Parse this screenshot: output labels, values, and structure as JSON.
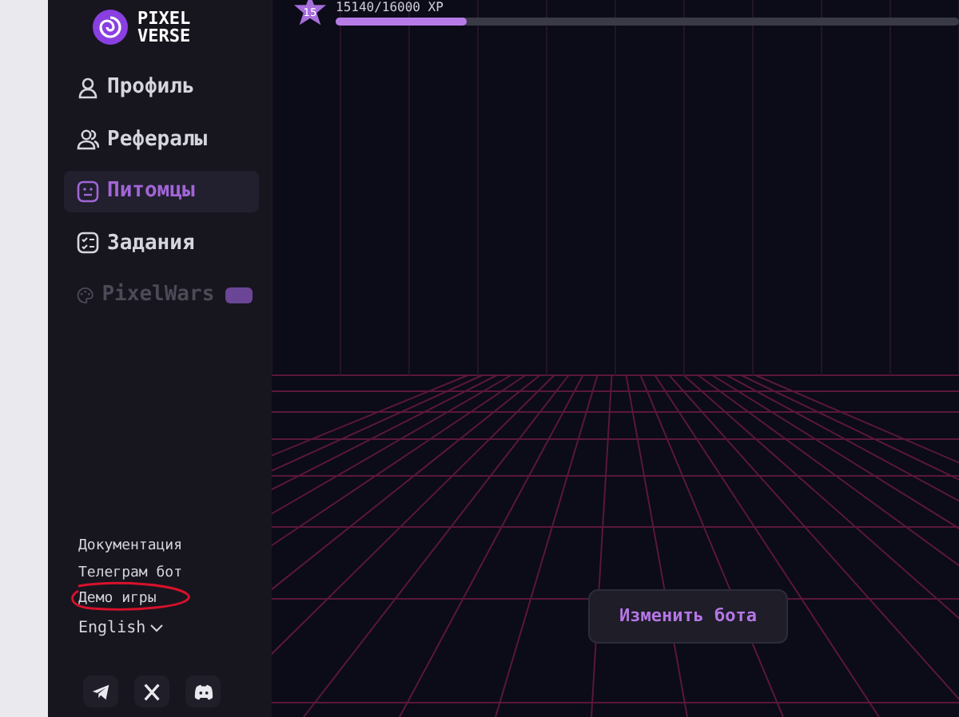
{
  "brand": {
    "line_1": "PIXEL",
    "line_2": "VERSE"
  },
  "level_badge": "15",
  "xp": {
    "reading": "15140/16000 XP",
    "level": 0.21
  },
  "nav": [
    {
      "label": "Профиль",
      "kind": "user",
      "selected": false,
      "disabled": false
    },
    {
      "label": "Рефералы",
      "kind": "users",
      "selected": false,
      "disabled": false
    },
    {
      "label": "Питомцы",
      "kind": "pet",
      "selected": true,
      "disabled": false
    },
    {
      "label": "Задания",
      "kind": "tasks",
      "selected": false,
      "disabled": false
    },
    {
      "label": "PixelWars",
      "kind": "palette",
      "selected": false,
      "disabled": true
    }
  ],
  "footer_links": [
    {
      "label": "Документация",
      "circled": false
    },
    {
      "label": "Телеграм бот",
      "circled": false
    },
    {
      "label": "Демо игры",
      "circled": true
    }
  ],
  "language": "English",
  "socials": [
    {
      "kind": "telegram"
    },
    {
      "kind": "x"
    },
    {
      "kind": "discord"
    }
  ],
  "action_button": "Изменить бота"
}
